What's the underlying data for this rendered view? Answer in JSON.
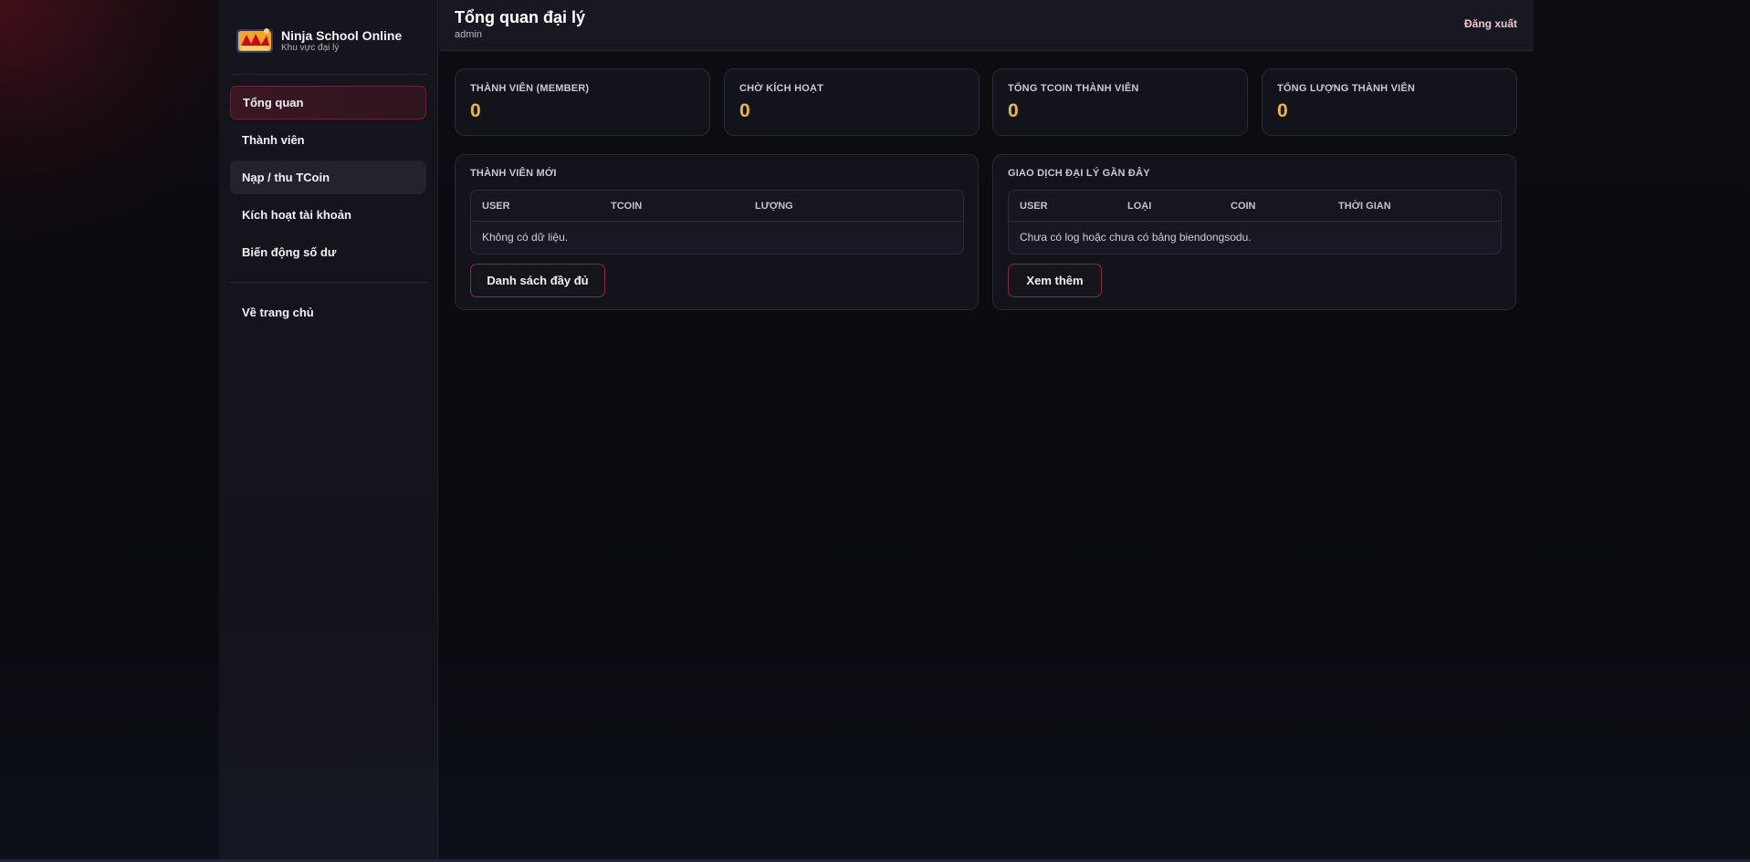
{
  "brand": {
    "title": "Ninja School Online",
    "subtitle": "Khu vực đại lý",
    "logo_icon": "ninja-school-logo-icon"
  },
  "sidebar": {
    "items": [
      {
        "label": "Tổng quan",
        "active": true
      },
      {
        "label": "Thành viên"
      },
      {
        "label": "Nạp / thu TCoin",
        "hovered": true
      },
      {
        "label": "Kích hoạt tài khoản"
      },
      {
        "label": "Biến động số dư"
      }
    ],
    "home_label": "Về trang chủ"
  },
  "header": {
    "title": "Tổng quan đại lý",
    "username": "admin",
    "logout_label": "Đăng xuất"
  },
  "stats": [
    {
      "label": "THÀNH VIÊN (MEMBER)",
      "value": "0"
    },
    {
      "label": "CHỜ KÍCH HOẠT",
      "value": "0"
    },
    {
      "label": "TỔNG TCOIN THÀNH VIÊN",
      "value": "0"
    },
    {
      "label": "TỔNG LƯỢNG THÀNH VIÊN",
      "value": "0"
    }
  ],
  "new_members": {
    "title": "THÀNH VIÊN MỚI",
    "columns": [
      "USER",
      "TCOIN",
      "LƯỢNG"
    ],
    "empty_text": "Không có dữ liệu.",
    "button_label": "Danh sách đầy đủ"
  },
  "recent_transactions": {
    "title": "GIAO DỊCH ĐẠI LÝ GẦN ĐÂY",
    "columns": [
      "USER",
      "LOẠI",
      "COIN",
      "THỜI GIAN"
    ],
    "empty_text": "Chưa có log hoặc chưa có bảng biendongsodu.",
    "button_label": "Xem thêm"
  },
  "colors": {
    "accent": "#f1b92b",
    "active_border": "#6a2435",
    "button_border": "#8a2b3e"
  }
}
